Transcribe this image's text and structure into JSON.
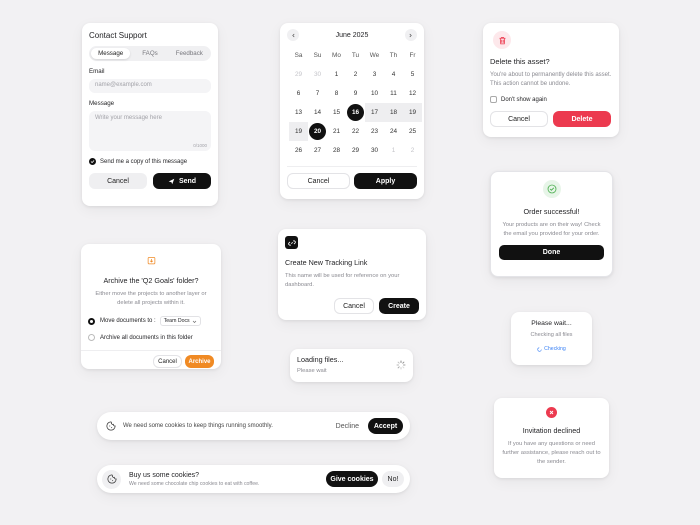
{
  "contact": {
    "title": "Contact Support",
    "tabs": [
      "Message",
      "FAQs",
      "Feedback"
    ],
    "email_label": "Email",
    "email_placeholder": "name@example.com",
    "message_label": "Message",
    "message_placeholder": "Write your message here",
    "char_count": "0/1000",
    "copy_label": "Send me a copy of this message",
    "cancel": "Cancel",
    "send": "Send"
  },
  "calendar": {
    "month": "June 2025",
    "weekdays": [
      "Sa",
      "Su",
      "Mo",
      "Tu",
      "We",
      "Th",
      "Fr"
    ],
    "days": [
      [
        "29",
        "30",
        "1",
        "2",
        "3",
        "4",
        "5"
      ],
      [
        "6",
        "7",
        "8",
        "9",
        "10",
        "11",
        "12"
      ],
      [
        "13",
        "14",
        "15",
        "16",
        "17",
        "18",
        "19"
      ],
      [
        "19",
        "20",
        "21",
        "22",
        "23",
        "24",
        "25"
      ],
      [
        "26",
        "27",
        "28",
        "29",
        "30",
        "1",
        "2"
      ]
    ],
    "cancel": "Cancel",
    "apply": "Apply"
  },
  "delete_asset": {
    "title": "Delete this asset?",
    "body": "You're about to permanently delete this asset. This action cannot be undone.",
    "checkbox": "Don't show again",
    "cancel": "Cancel",
    "delete": "Delete",
    "color": "#ec3a4f"
  },
  "order": {
    "title": "Order successful!",
    "body": "Your products are on their way! Check the email you provided for your order.",
    "done": "Done",
    "color": "#4caf50"
  },
  "archive": {
    "title": "Archive the 'Q2 Goals' folder?",
    "body": "Either move the projects to another layer or delete all projects within it.",
    "option1": "Move documents to :",
    "option1_select": "Team Docs",
    "option2": "Archive all documents in this folder",
    "cancel": "Cancel",
    "archive": "Archive",
    "color": "#f08a24"
  },
  "tracking": {
    "title": "Create New Tracking Link",
    "body": "This name will be used for reference on your dashboard.",
    "cancel": "Cancel",
    "create": "Create"
  },
  "please_wait": {
    "title": "Please wait...",
    "body": "Checking all files",
    "status": "Checking",
    "color": "#3b82f6"
  },
  "loading": {
    "title": "Loading files...",
    "body": "Please wait"
  },
  "cookie1": {
    "text": "We need some cookies to keep things running smoothly.",
    "decline": "Decline",
    "accept": "Accept"
  },
  "cookie2": {
    "title": "Buy us some cookies?",
    "body": "We need some chocolate chip cookies to eat with coffee.",
    "give": "Give cookies",
    "no": "No!"
  },
  "invitation": {
    "title": "Invitation declined",
    "body": "If you have any questions or need further assistance, please reach out to the sender.",
    "color": "#ec3a4f"
  }
}
